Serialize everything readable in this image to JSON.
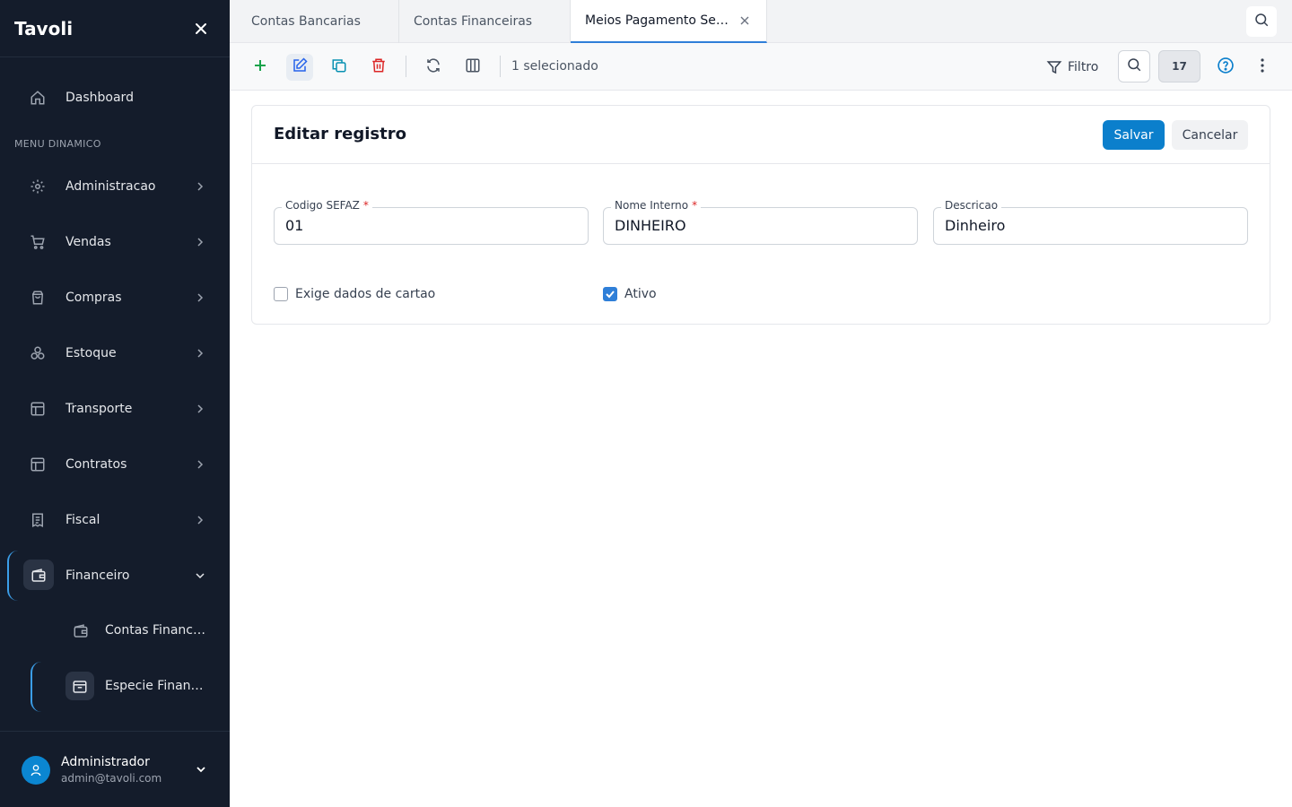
{
  "sidebar": {
    "brand": "Tavoli",
    "dashboard_label": "Dashboard",
    "section_label": "MENU DINAMICO",
    "items": [
      {
        "label": "Administracao",
        "icon": "gear-icon"
      },
      {
        "label": "Vendas",
        "icon": "cart-icon"
      },
      {
        "label": "Compras",
        "icon": "shopping-bag-icon"
      },
      {
        "label": "Estoque",
        "icon": "boxes-icon"
      },
      {
        "label": "Transporte",
        "icon": "layout-icon"
      },
      {
        "label": "Contratos",
        "icon": "layout-icon"
      },
      {
        "label": "Fiscal",
        "icon": "receipt-icon"
      },
      {
        "label": "Financeiro",
        "icon": "wallet-icon",
        "expanded": true
      }
    ],
    "subitems": [
      {
        "label": "Contas Financeiras",
        "icon": "wallet-icon"
      },
      {
        "label": "Especie Financeira",
        "icon": "archive-icon",
        "active": true
      }
    ],
    "user": {
      "name": "Administrador",
      "email": "admin@tavoli.com"
    }
  },
  "tabs": [
    {
      "label": "Contas Bancarias"
    },
    {
      "label": "Contas Financeiras"
    },
    {
      "label": "Meios Pagamento Sefaz",
      "active": true
    }
  ],
  "toolbar": {
    "selection_status": "1 selecionado",
    "filter_label": "Filtro",
    "record_count": "17"
  },
  "form": {
    "title": "Editar registro",
    "save_label": "Salvar",
    "cancel_label": "Cancelar",
    "fields": [
      {
        "label": "Codigo SEFAZ",
        "required": "*",
        "value": "01"
      },
      {
        "label": "Nome Interno",
        "required": "*",
        "value": "DINHEIRO"
      },
      {
        "label": "Descricao",
        "value": "Dinheiro"
      }
    ],
    "checkboxes": [
      {
        "label": "Exige dados de cartao",
        "checked": false
      },
      {
        "label": "Ativo",
        "checked": true
      }
    ]
  },
  "colors": {
    "sidebar_bg": "#141c2b",
    "accent": "#0b7fcc",
    "tab_active_border": "#2f7fd8"
  }
}
